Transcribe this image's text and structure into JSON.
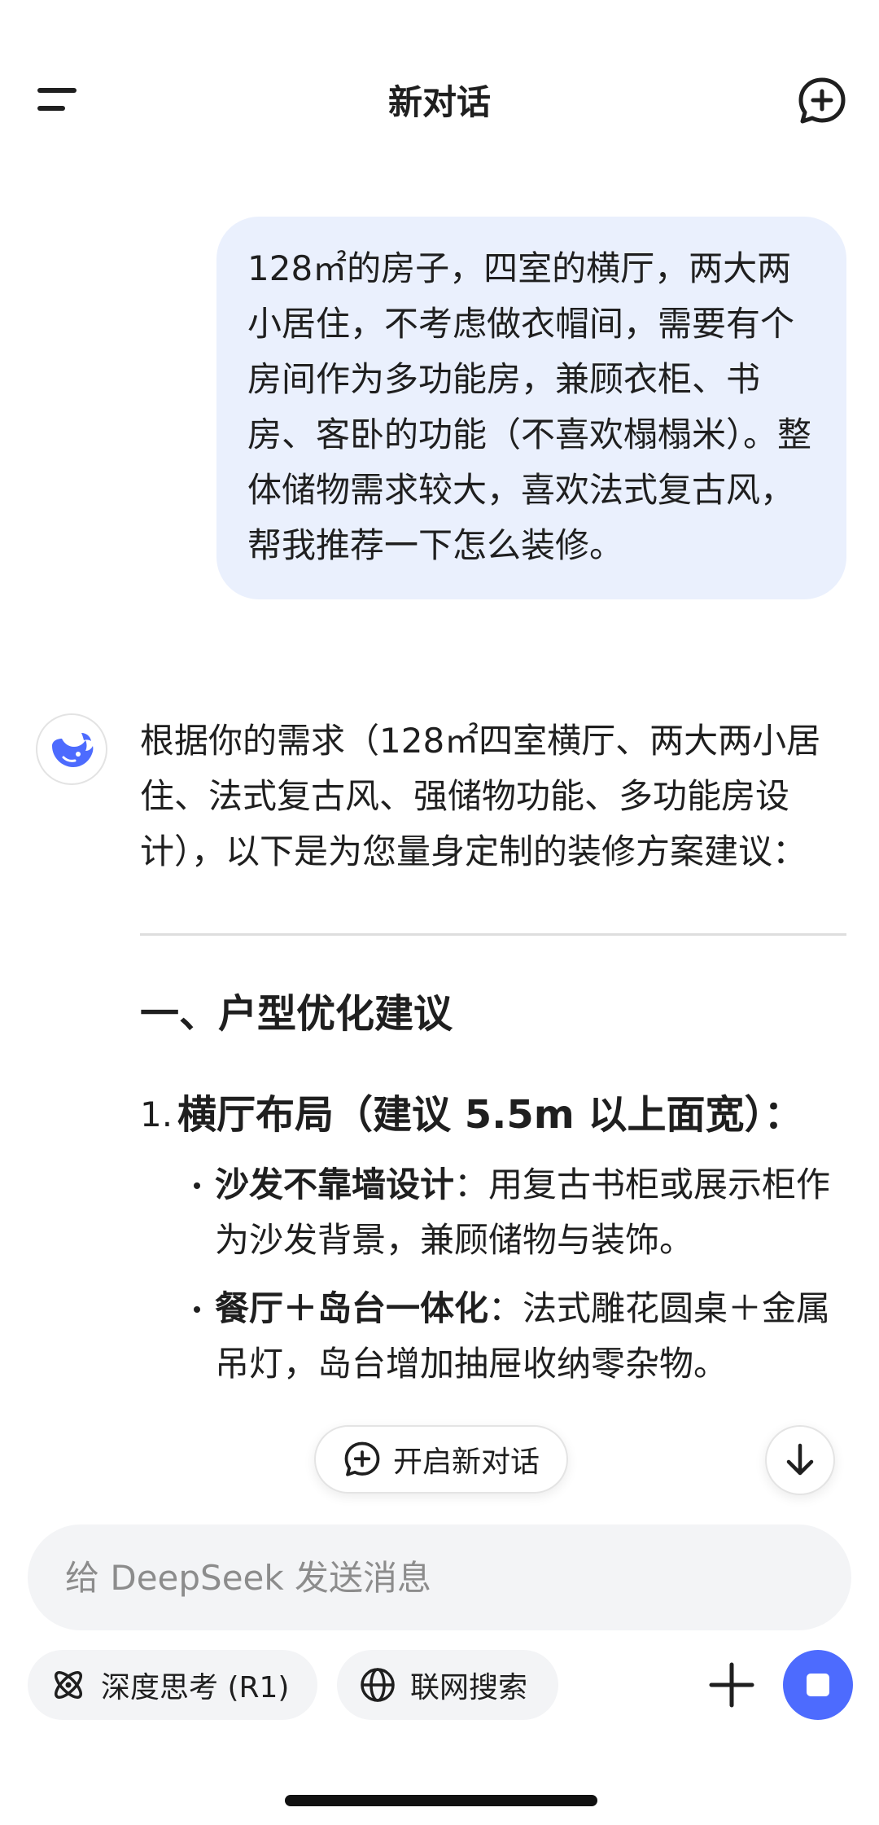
{
  "header": {
    "title": "新对话"
  },
  "conversation": {
    "user_message": "128㎡的房子，四室的横厅，两大两小居住，不考虑做衣帽间，需要有个房间作为多功能房，兼顾衣柜、书房、客卧的功能（不喜欢榻榻米）。整体储物需求较大，喜欢法式复古风，帮我推荐一下怎么装修。",
    "assistant": {
      "intro": "根据你的需求（128㎡四室横厅、两大两小居住、法式复古风、强储物功能、多功能房设计），以下是为您量身定制的装修方案建议：",
      "section_title": "一、户型优化建议",
      "item_number": "1.",
      "item_title": "横厅布局（建议 5.5m 以上面宽）：",
      "bullets": [
        {
          "bold": "沙发不靠墙设计",
          "text": "：用复古书柜或展示柜作为沙发背景，兼顾储物与装饰。"
        },
        {
          "bold": "餐厅＋岛台一体化",
          "text": "：法式雕花圆桌＋金属吊灯，岛台增加抽屉收纳零杂物。"
        }
      ]
    }
  },
  "floating": {
    "new_chat_label": "开启新对话"
  },
  "composer": {
    "placeholder": "给 DeepSeek 发送消息",
    "value": ""
  },
  "toolbar": {
    "deep_think_label": "深度思考 (R1)",
    "web_search_label": "联网搜索"
  },
  "colors": {
    "accent": "#4d6bfe",
    "user_bubble": "#eaf0fd",
    "input_bg": "#f3f4f6"
  },
  "icons": {
    "menu": "menu-icon",
    "new_chat": "chat-plus-icon",
    "avatar": "deepseek-whale-icon",
    "scroll_down": "arrow-down-icon",
    "deep_think": "atom-icon",
    "web_search": "globe-icon",
    "attach": "plus-icon",
    "stop": "stop-icon"
  }
}
